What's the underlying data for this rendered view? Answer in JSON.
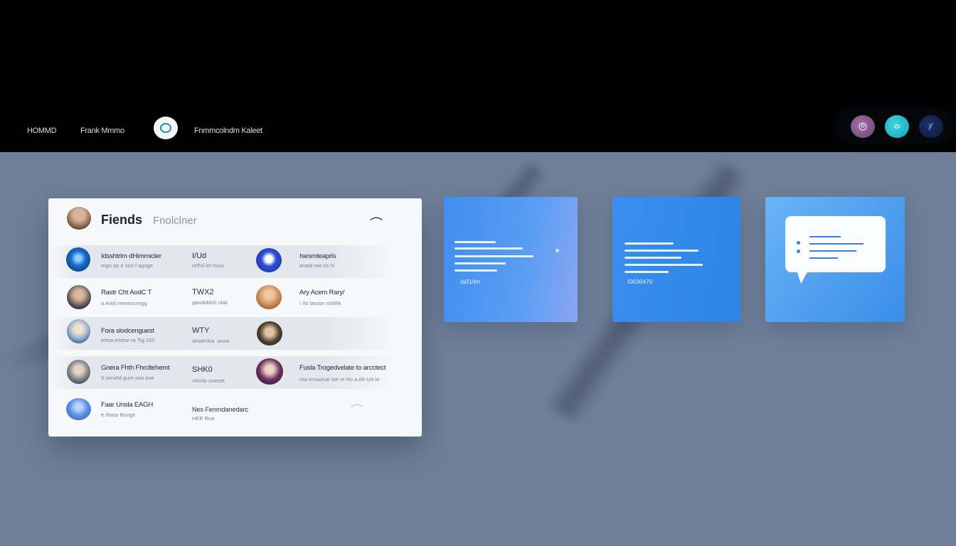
{
  "header": {
    "nav_home": "HOMMD",
    "nav_profile": "Frank Mmmo",
    "nav_notifications": "Fnmmcolndm Kaleet"
  },
  "friends_panel": {
    "title": "Fiends",
    "subtitle": "Fnolclner",
    "rows": [
      {
        "left": {
          "name": "Idsshtrlm dHimmicler",
          "meta": "ergo ep e soo f agoge",
          "count": "I/Ud",
          "count_meta": "rirfhd lel rsuis",
          "avatar_color": "#1a6fd0"
        },
        "right": {
          "name": "Isesmteaprls",
          "meta": "anaid reo ris h/"
        }
      },
      {
        "left": {
          "name": "Rastr Cht AodC T",
          "meta": "a Anid neemocregg",
          "count": "TWX2",
          "count_meta": "gaodiddsh slak",
          "avatar_color": "#6a5a4a"
        },
        "right": {
          "name": "Ary Acem Rary/",
          "meta": "I Ito lanoor roMhk"
        }
      },
      {
        "left": {
          "name": "Fora slodcenguest",
          "meta": "ertoa enrtse ra Tig 102",
          "count": "WTY",
          "count_meta": "ahwenkia .anoo",
          "avatar_color": "#9fb4c8"
        },
        "right": {
          "name": "",
          "meta": ""
        }
      },
      {
        "left": {
          "name": "Gnera Fhth Fhrcltehemt",
          "meta": "9 cenetd gure oea eve",
          "count": "SHK0",
          "count_meta": "rrtimlo oneoet",
          "avatar_color": "#7a7f86"
        },
        "right": {
          "name": "Fusla Trogedvelate to arcctect",
          "meta": "rna emuorue ste re Ho a Ah UA te"
        }
      },
      {
        "left": {
          "name": "Faar Unsla EAGH",
          "meta": "e thsep Bonge",
          "count": "Nes Fenmdanedarc",
          "count_meta": "HEE Roa",
          "avatar_color": "#5b8ee0"
        },
        "right": {
          "name": "",
          "meta": ""
        }
      }
    ]
  },
  "cards": [
    {
      "label": "Ia01/bn"
    },
    {
      "label": "I0036470"
    },
    {
      "label": ""
    }
  ]
}
